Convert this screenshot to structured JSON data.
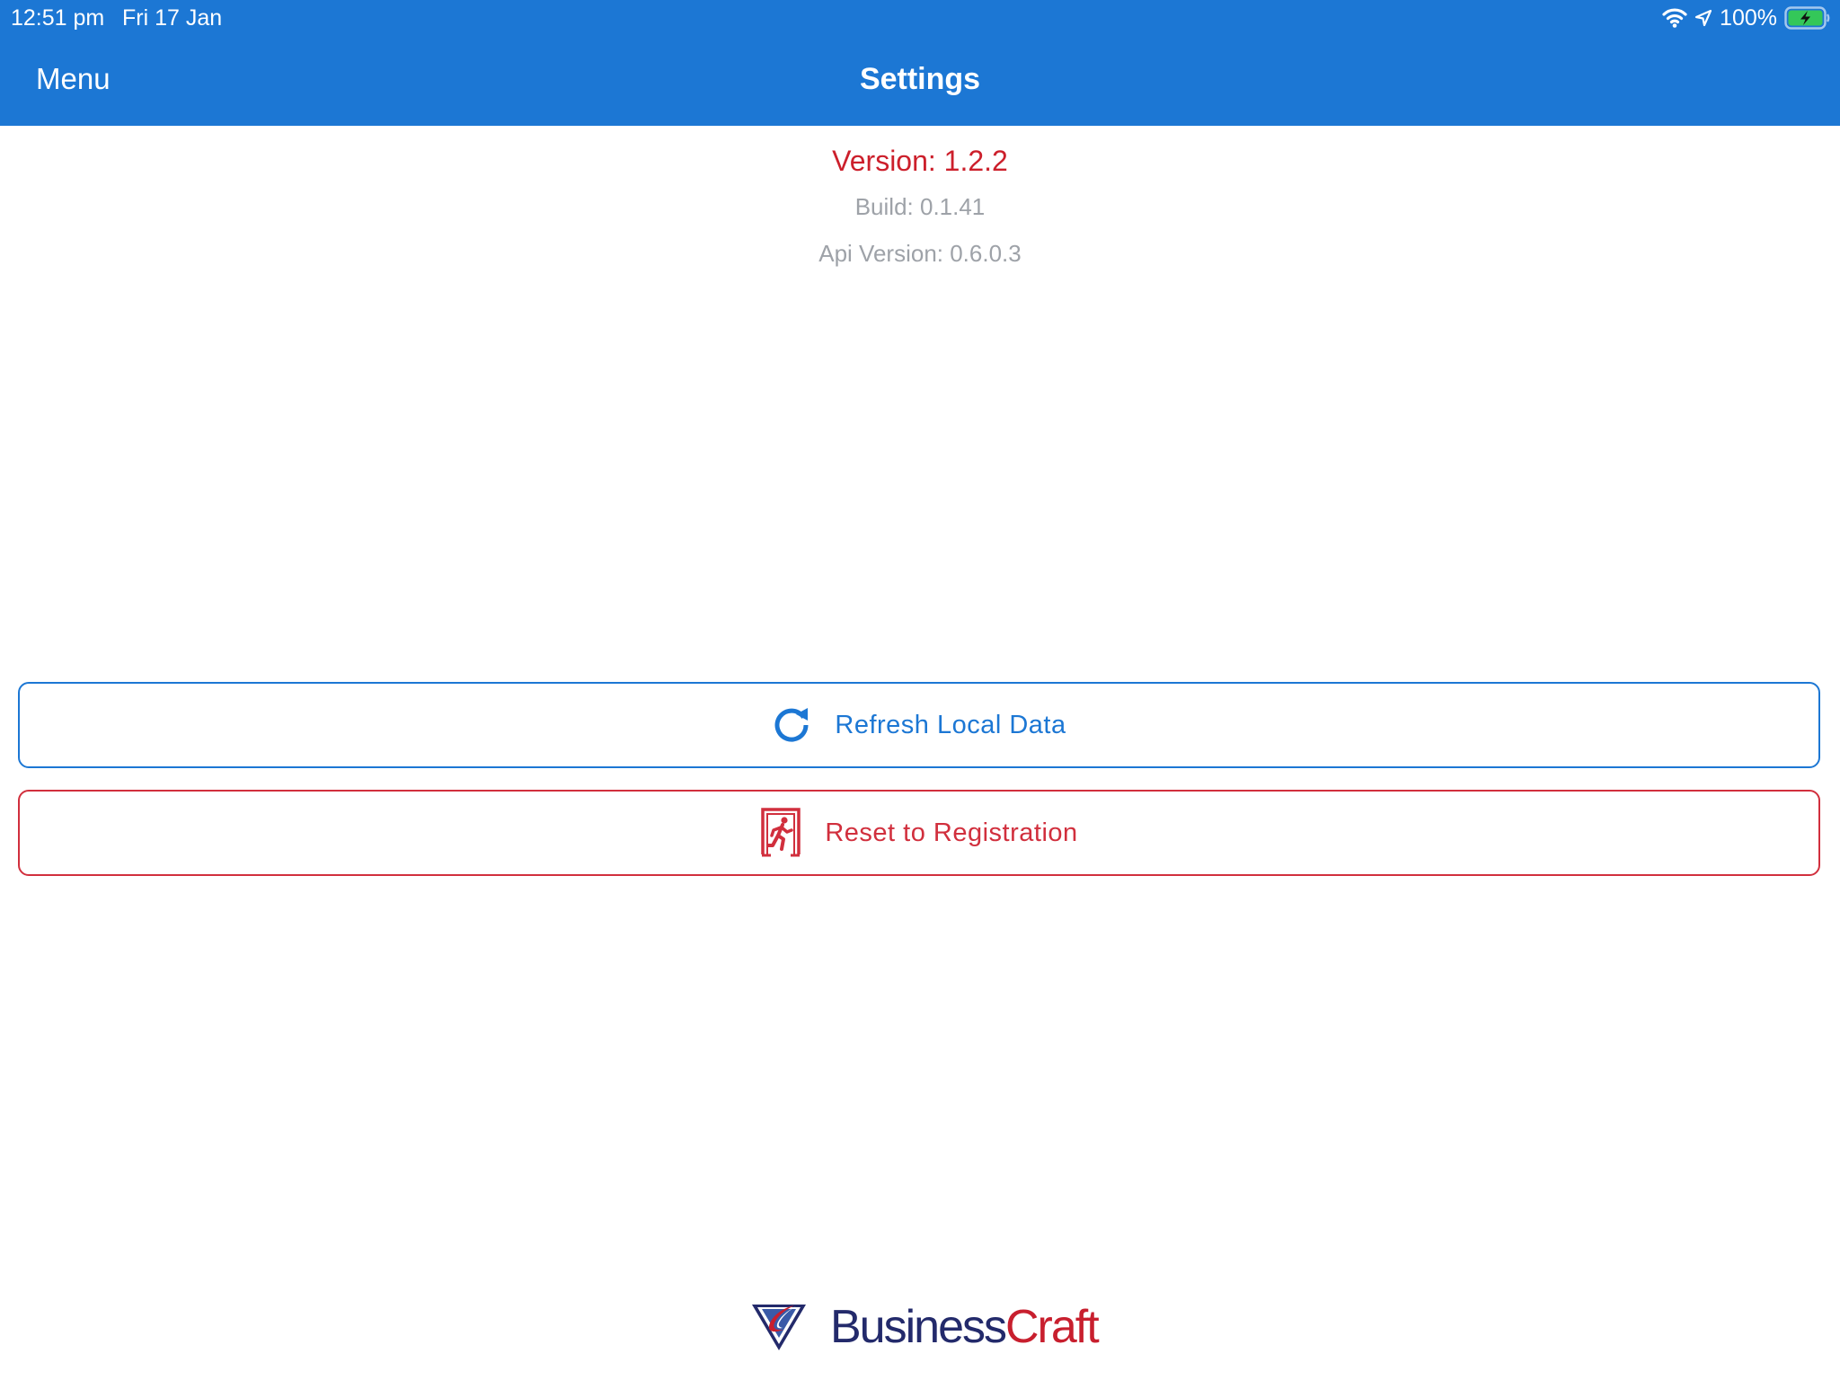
{
  "status_bar": {
    "time": "12:51 pm",
    "date": "Fri 17 Jan",
    "battery": "100%",
    "icons": [
      "wifi-icon",
      "location-arrow-icon",
      "battery-charging-icon"
    ]
  },
  "nav": {
    "menu_label": "Menu",
    "title": "Settings"
  },
  "info": {
    "version": "Version: 1.2.2",
    "build": "Build: 0.1.41",
    "api_version": "Api Version: 0.6.0.3"
  },
  "actions": {
    "refresh": {
      "label": "Refresh Local Data",
      "icon": "refresh-icon"
    },
    "reset": {
      "label": "Reset to Registration",
      "icon": "emergency-exit-icon"
    }
  },
  "logo": {
    "word_1": "Business",
    "word_2": "Craft"
  },
  "colors": {
    "header": "#1c77d4",
    "version_text": "#cc1f2b",
    "muted_text": "#9ea2a8",
    "refresh_accent": "#1c77d4",
    "reset_accent": "#d12f3d",
    "logo_navy": "#232a6b",
    "logo_red": "#c81f2e",
    "battery_fill": "#34c759"
  }
}
